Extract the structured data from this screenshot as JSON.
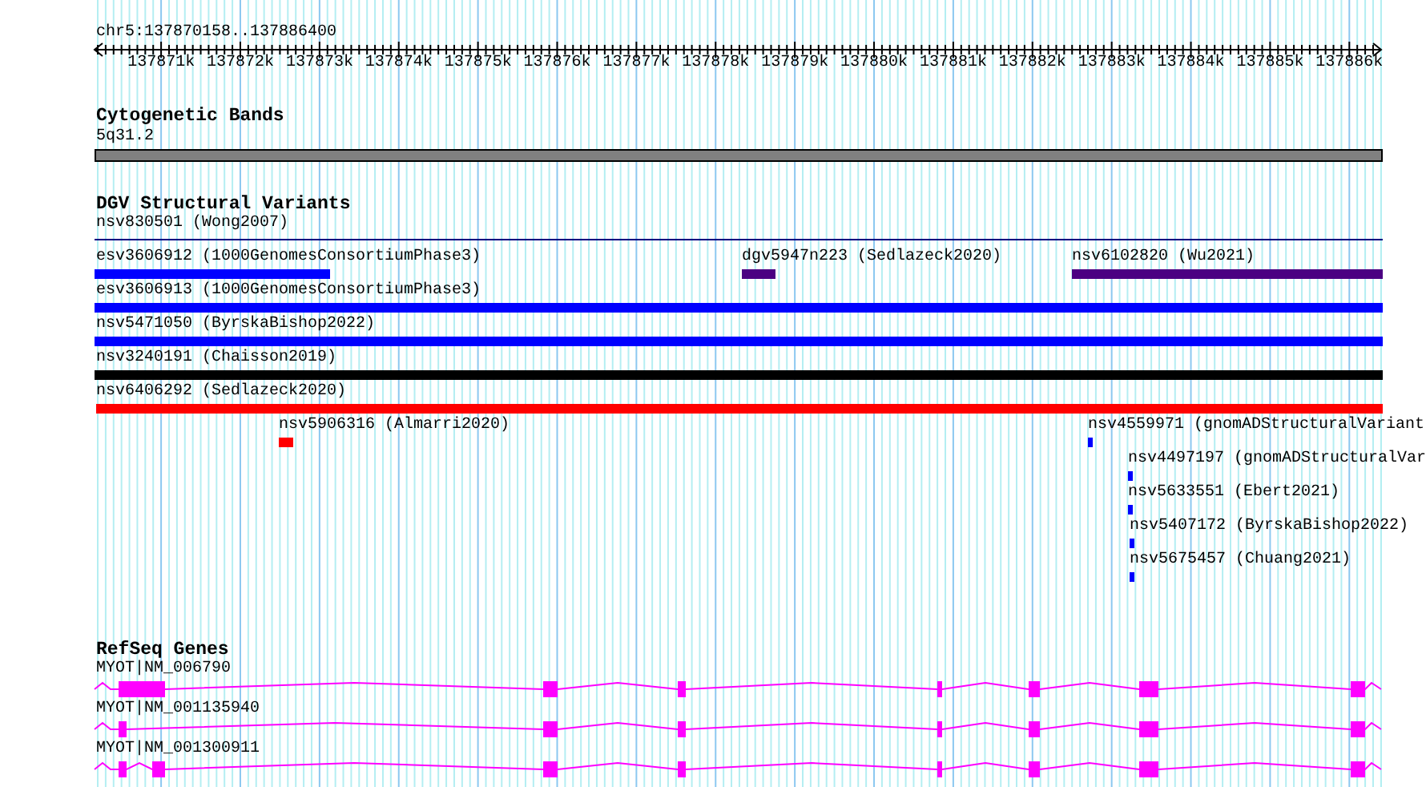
{
  "ruler": {
    "location": "chr5:137870158..137886400",
    "ticks": [
      "137871k",
      "137872k",
      "137873k",
      "137874k",
      "137875k",
      "137876k",
      "137877k",
      "137878k",
      "137879k",
      "137880k",
      "137881k",
      "137882k",
      "137883k",
      "137884k",
      "137885k",
      "137886k"
    ]
  },
  "tracks": [
    {
      "kind": "bands",
      "title": "Cytogenetic Bands",
      "features": [
        {
          "label": "5q31.2",
          "color": "#808080"
        }
      ]
    },
    {
      "kind": "variants",
      "title": "DGV Structural Variants",
      "features": [
        {
          "label": "nsv830501 (Wong2007)",
          "kind": "line",
          "color": "#000080"
        },
        {
          "label": "esv3606912 (1000GenomesConsortiumPhase3)",
          "kind": "bar",
          "color": "#0000ff"
        },
        {
          "label": "dgv5947n223 (Sedlazeck2020)",
          "kind": "bar",
          "color": "#4b0082"
        },
        {
          "label": "nsv6102820 (Wu2021)",
          "kind": "bar",
          "color": "#4b0082"
        },
        {
          "label": "esv3606913 (1000GenomesConsortiumPhase3)",
          "kind": "bar",
          "color": "#0000ff"
        },
        {
          "label": "nsv5471050 (ByrskaBishop2022)",
          "kind": "bar",
          "color": "#0000ff"
        },
        {
          "label": "nsv3240191 (Chaisson2019)",
          "kind": "bar",
          "color": "#000000"
        },
        {
          "label": "nsv6406292 (Sedlazeck2020)",
          "kind": "bar",
          "color": "#ff0000"
        },
        {
          "label": "nsv5906316 (Almarri2020)",
          "kind": "bar",
          "color": "#ff0000"
        },
        {
          "label": "nsv4559971 (gnomADStructuralVariant",
          "kind": "bar",
          "color": "#0000ff"
        },
        {
          "label": "nsv4497197 (gnomADStructuralVar",
          "kind": "bar",
          "color": "#0000ff"
        },
        {
          "label": "nsv5633551 (Ebert2021)",
          "kind": "bar",
          "color": "#0000ff"
        },
        {
          "label": "nsv5407172 (ByrskaBishop2022)",
          "kind": "bar",
          "color": "#0000ff"
        },
        {
          "label": "nsv5675457 (Chuang2021)",
          "kind": "bar",
          "color": "#0000ff"
        }
      ]
    },
    {
      "kind": "genes",
      "title": "RefSeq Genes",
      "features": [
        {
          "label": "MYOT|NM_006790",
          "color": "#ff00ff"
        },
        {
          "label": "MYOT|NM_001135940",
          "color": "#ff00ff"
        },
        {
          "label": "MYOT|NM_001300911",
          "color": "#ff00ff"
        }
      ]
    }
  ]
}
